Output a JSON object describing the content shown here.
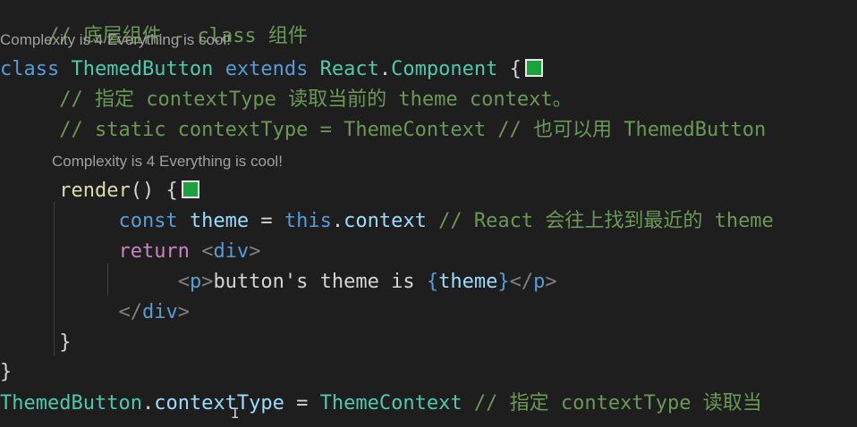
{
  "editor": {
    "theme_colors": {
      "background": "#1e1e1e",
      "comment": "#6a9955",
      "keyword": "#569cd6",
      "class": "#4ec9b0",
      "function": "#dcdcaa",
      "variable": "#9cdcfe",
      "control": "#c586c0",
      "color_swatch": "#1aa33a"
    },
    "code_lens_1": "Complexity is 4 Everything is cool!",
    "code_lens_2": "Complexity is 4 Everything is cool!",
    "lines": {
      "l1": {
        "comment": "// 底层组件 - class 组件"
      },
      "l2": {
        "kw_class": "class",
        "name": "ThemedButton",
        "kw_extends": "extends",
        "base_obj": "React",
        "dot": ".",
        "base_cls": "Component",
        "brace": "{"
      },
      "l3": {
        "comment": "// 指定 contextType 读取当前的 theme context。"
      },
      "l4": {
        "comment": "// static contextType = ThemeContext // 也可以用 ThemedButton"
      },
      "l5": {
        "fn": "render",
        "parens": "()",
        "brace": "{"
      },
      "l6": {
        "kw_const": "const",
        "var": "theme",
        "eq": "=",
        "kw_this": "this",
        "dot": ".",
        "prop": "context",
        "comment": "// React 会往上找到最近的 theme"
      },
      "l7": {
        "kw_return": "return",
        "open": "<",
        "tag": "div",
        "close": ">"
      },
      "l8": {
        "open": "<",
        "tag": "p",
        "close": ">",
        "text": "button's theme is ",
        "lbrace": "{",
        "expr": "theme",
        "rbrace": "}",
        "end_open": "</",
        "end_tag": "p",
        "end_close": ">"
      },
      "l9": {
        "end_open": "</",
        "tag": "div",
        "close": ">"
      },
      "l10": {
        "brace": "}"
      },
      "l11": {
        "brace": "}"
      },
      "l12": {
        "obj": "ThemedButton",
        "dot": ".",
        "prop": "contextType",
        "eq": "=",
        "value": "ThemeContext",
        "comment": "// 指定 contextType 读取当"
      }
    }
  }
}
